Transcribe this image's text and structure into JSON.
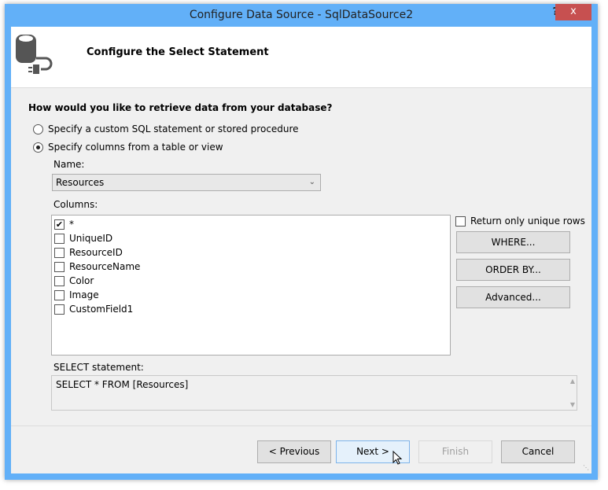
{
  "window": {
    "title": "Configure Data Source - SqlDataSource2",
    "help": "?",
    "close": "x"
  },
  "header": {
    "title": "Configure the Select Statement"
  },
  "question": "How would you like to retrieve data from your database?",
  "options": [
    {
      "label": "Specify a custom SQL statement or stored procedure",
      "selected": false
    },
    {
      "label": "Specify columns from a table or view",
      "selected": true
    }
  ],
  "name_label": "Name:",
  "name_value": "Resources",
  "columns_label": "Columns:",
  "columns": [
    {
      "label": "*",
      "checked": true
    },
    {
      "label": "UniqueID",
      "checked": false
    },
    {
      "label": "ResourceID",
      "checked": false
    },
    {
      "label": "ResourceName",
      "checked": false
    },
    {
      "label": "Color",
      "checked": false
    },
    {
      "label": "Image",
      "checked": false
    },
    {
      "label": "CustomField1",
      "checked": false
    }
  ],
  "unique_rows": {
    "label": "Return only unique rows",
    "checked": false
  },
  "buttons": {
    "where": "WHERE...",
    "order_by": "ORDER BY...",
    "advanced": "Advanced...",
    "previous": "< Previous",
    "next": "Next >",
    "finish": "Finish",
    "cancel": "Cancel"
  },
  "select_label": "SELECT statement:",
  "select_value": "SELECT * FROM [Resources]"
}
